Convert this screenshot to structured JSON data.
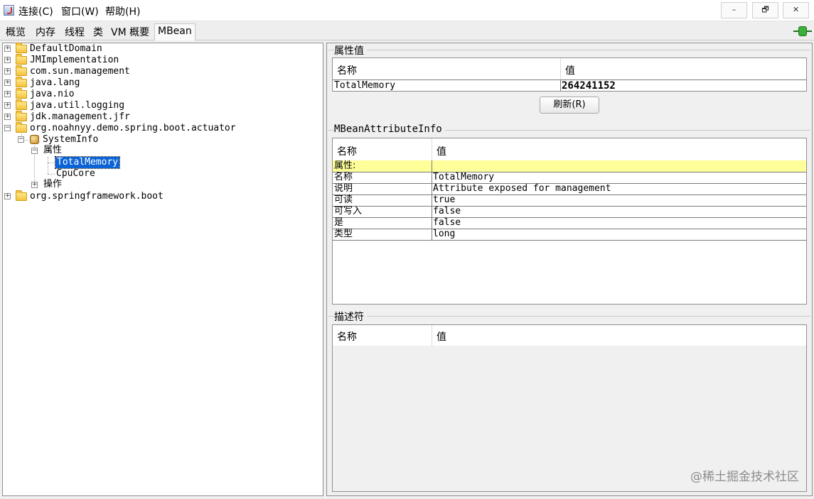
{
  "menu": [
    "连接(C)",
    "窗口(W)",
    "帮助(H)"
  ],
  "window_buttons": {
    "minimize": "–",
    "restore": "🗗",
    "close": "✕"
  },
  "tabs": [
    "概览",
    "内存",
    "线程",
    "类",
    "VM 概要",
    "MBean"
  ],
  "active_tab": "MBean",
  "tree": {
    "domains_top": [
      "DefaultDomain",
      "JMImplementation",
      "com.sun.management",
      "java.lang",
      "java.nio",
      "java.util.logging",
      "jdk.management.jfr"
    ],
    "expanded_domain": "org.noahnyy.demo.spring.boot.actuator",
    "bean": "SystemInfo",
    "attributes_folder": "属性",
    "attributes": [
      "TotalMemory",
      "CpuCore"
    ],
    "operations_folder": "操作",
    "domains_bottom": [
      "org.springframework.boot"
    ],
    "selected": "TotalMemory"
  },
  "attribute_values": {
    "title": "属性值",
    "col_name": "名称",
    "col_value": "值",
    "row_name": "TotalMemory",
    "row_value": "264241152",
    "refresh_label": "刷新(R)"
  },
  "attribute_info": {
    "title": "MBeanAttributeInfo",
    "col_name": "名称",
    "col_value": "值",
    "group_label": "属性:",
    "rows": [
      {
        "name": "名称",
        "value": "TotalMemory"
      },
      {
        "name": "说明",
        "value": "Attribute exposed for management"
      },
      {
        "name": "可读",
        "value": "true"
      },
      {
        "name": "可写入",
        "value": "false"
      },
      {
        "name": "是",
        "value": "false"
      },
      {
        "name": "类型",
        "value": "long"
      }
    ],
    "highlight_color": "#ffff99"
  },
  "descriptor": {
    "title": "描述符",
    "col_name": "名称",
    "col_value": "值"
  },
  "watermark": "@稀土掘金技术社区",
  "colors": {
    "selection": "#0a64d6",
    "status_connected": "#3cae3a"
  }
}
